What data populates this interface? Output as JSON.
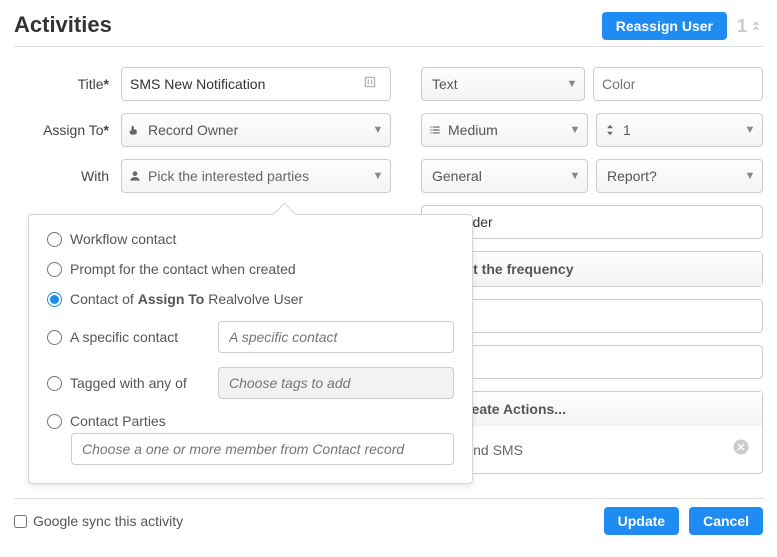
{
  "header": {
    "title": "Activities",
    "reassign_label": "Reassign User",
    "counter": "1"
  },
  "form": {
    "labels": {
      "title": "Title",
      "assign_to": "Assign To",
      "with": "With"
    },
    "title_value": "SMS New Notification",
    "assign_to_value": "Record Owner",
    "with_placeholder": "Pick the interested parties"
  },
  "right": {
    "row1": {
      "type_value": "Text",
      "color_placeholder": "Color"
    },
    "row2": {
      "priority_value": "Medium",
      "number_value": "1"
    },
    "row3": {
      "category_value": "General",
      "report_value": "Report?"
    },
    "reminder_value": "Reminder",
    "frequency_label": "Set the frequency",
    "create_actions_label": "Create Actions...",
    "action_item": "Send SMS"
  },
  "popover": {
    "opt_workflow": "Workflow contact",
    "opt_prompt": "Prompt for the contact when created",
    "opt_contact_of_pre": "Contact of ",
    "opt_contact_of_bold": "Assign To",
    "opt_contact_of_post": " Realvolve User",
    "opt_specific": "A specific contact",
    "specific_placeholder": "A specific contact",
    "opt_tagged": "Tagged with any of",
    "tagged_placeholder": "Choose tags to add",
    "opt_parties": "Contact Parties",
    "parties_placeholder": "Choose a one or more member from Contact record"
  },
  "footer": {
    "sync_label": "Google sync this activity",
    "update": "Update",
    "cancel": "Cancel"
  }
}
